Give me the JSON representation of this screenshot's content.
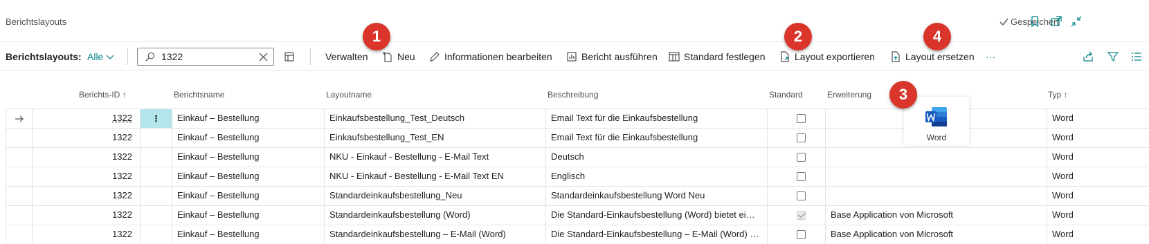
{
  "page": {
    "title": "Berichtslayouts",
    "saved_label": "Gespeichert"
  },
  "toolbar": {
    "label": "Berichtslayouts:",
    "filter": "Alle",
    "search_value": "1322",
    "actions": [
      "Verwalten",
      "Neu",
      "Informationen bearbeiten",
      "Bericht ausführen",
      "Standard festlegen",
      "Layout exportieren",
      "Layout ersetzen"
    ],
    "more": "···"
  },
  "columns": [
    "Berichts-ID ↑",
    "Berichtsname",
    "Layoutname",
    "Beschreibung",
    "Standard",
    "Erweiterung",
    "Typ ↑"
  ],
  "rows": [
    {
      "id": "1322",
      "report": "Einkauf – Bestellung",
      "layout": "Einkaufsbestellung_Test_Deutsch",
      "desc": "Email Text für die Einkaufsbestellung",
      "default": false,
      "ext": "",
      "type": "Word"
    },
    {
      "id": "1322",
      "report": "Einkauf – Bestellung",
      "layout": "Einkaufsbestellung_Test_EN",
      "desc": "Email Text für die Einkaufsbestellung",
      "default": false,
      "ext": "",
      "type": "Word"
    },
    {
      "id": "1322",
      "report": "Einkauf – Bestellung",
      "layout": "NKU - Einkauf - Bestellung - E-Mail Text",
      "desc": "Deutsch",
      "default": false,
      "ext": "",
      "type": "Word"
    },
    {
      "id": "1322",
      "report": "Einkauf – Bestellung",
      "layout": "NKU - Einkauf - Bestellung - E-Mail Text EN",
      "desc": "Englisch",
      "default": false,
      "ext": "",
      "type": "Word"
    },
    {
      "id": "1322",
      "report": "Einkauf – Bestellung",
      "layout": "Standardeinkaufsbestellung_Neu",
      "desc": "Standardeinkaufsbestellung Word Neu",
      "default": false,
      "ext": "",
      "type": "Word"
    },
    {
      "id": "1322",
      "report": "Einkauf – Bestellung",
      "layout": "Standardeinkaufsbestellung (Word)",
      "desc": "Die Standard-Einkaufsbestellung (Word) bietet ei…",
      "default": true,
      "ext": "Base Application von Microsoft",
      "type": "Word"
    },
    {
      "id": "1322",
      "report": "Einkauf – Bestellung",
      "layout": "Standardeinkaufsbestellung – E-Mail (Word)",
      "desc": "Die Standard-Einkaufsbestellung – E-Mail (Word) …",
      "default": false,
      "ext": "Base Application von Microsoft",
      "type": "Word"
    }
  ],
  "tooltip": {
    "label": "Word",
    "icon": "word-icon"
  },
  "badges": [
    "1",
    "2",
    "3",
    "4"
  ],
  "colors": {
    "accent": "#008489",
    "badge": "#d9352a",
    "selected_cell": "#b3e5ea",
    "word_blue": "#185abd"
  }
}
